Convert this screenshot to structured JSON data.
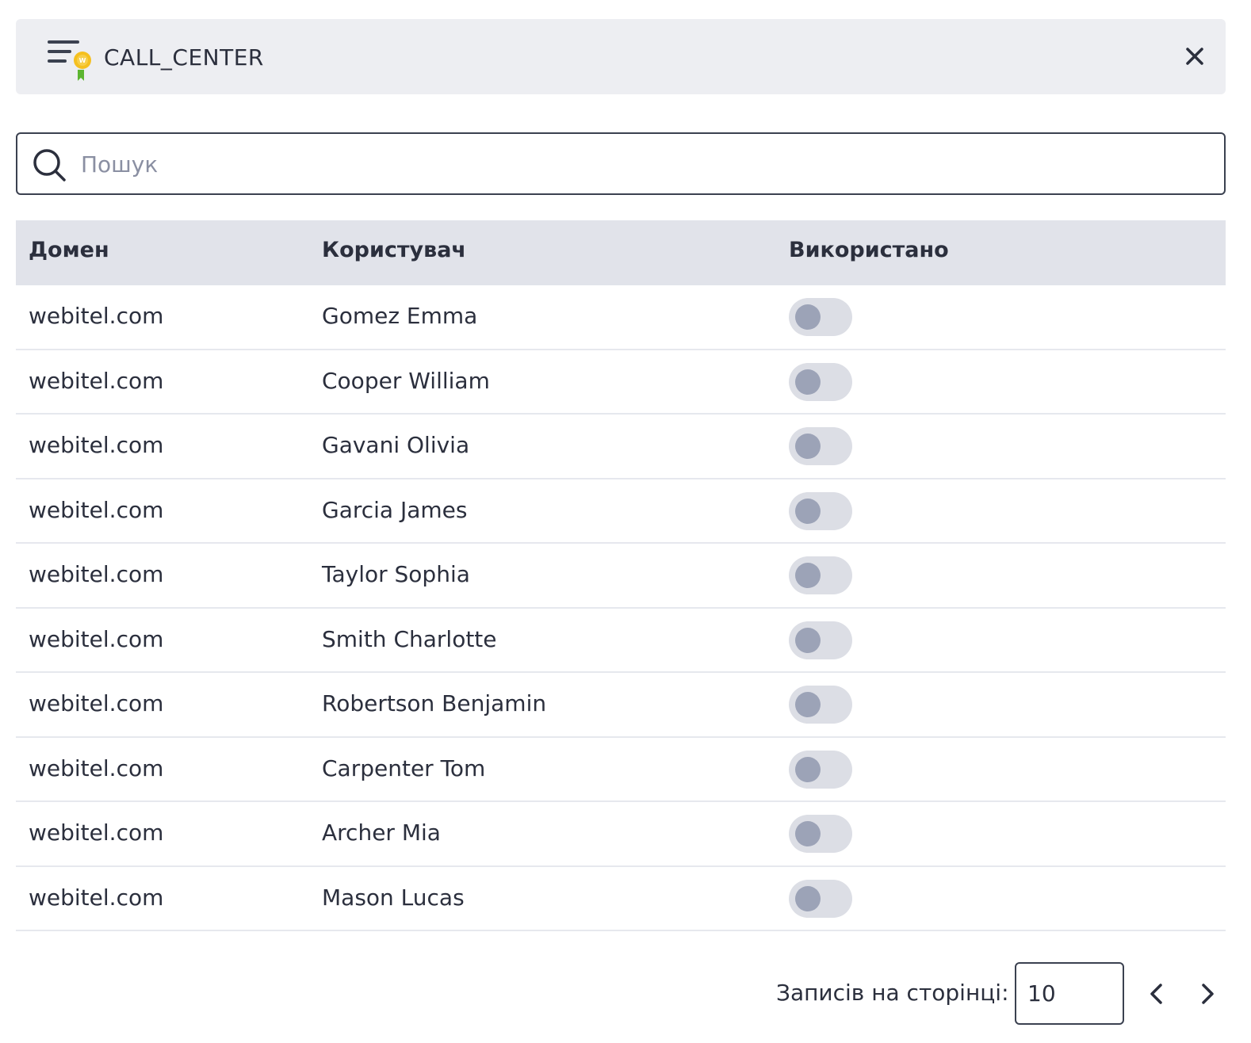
{
  "header": {
    "title": "CALL_CENTER",
    "icon": "license-icon",
    "close_icon": "close-icon"
  },
  "search": {
    "placeholder": "Пошук",
    "value": ""
  },
  "table": {
    "columns": [
      "Домен",
      "Користувач",
      "Використано"
    ],
    "rows": [
      {
        "domain": "webitel.com",
        "user": "Gomez Emma",
        "used": false
      },
      {
        "domain": "webitel.com",
        "user": "Cooper William",
        "used": false
      },
      {
        "domain": "webitel.com",
        "user": "Gavani Olivia",
        "used": false
      },
      {
        "domain": "webitel.com",
        "user": "Garcia James",
        "used": false
      },
      {
        "domain": "webitel.com",
        "user": "Taylor Sophia",
        "used": false
      },
      {
        "domain": "webitel.com",
        "user": "Smith Charlotte",
        "used": false
      },
      {
        "domain": "webitel.com",
        "user": "Robertson Benjamin",
        "used": false
      },
      {
        "domain": "webitel.com",
        "user": "Carpenter Tom",
        "used": false
      },
      {
        "domain": "webitel.com",
        "user": "Archer Mia",
        "used": false
      },
      {
        "domain": "webitel.com",
        "user": "Mason Lucas",
        "used": false
      }
    ]
  },
  "pagination": {
    "per_page_label": "Записів на сторінці:",
    "per_page_value": "10"
  },
  "colors": {
    "header_bg": "#edeef2",
    "table_header_bg": "#e1e3ea",
    "toggle_off_bg": "#dcdee5",
    "toggle_off_knob": "#9ca3b7",
    "text": "#2b2f3d"
  }
}
